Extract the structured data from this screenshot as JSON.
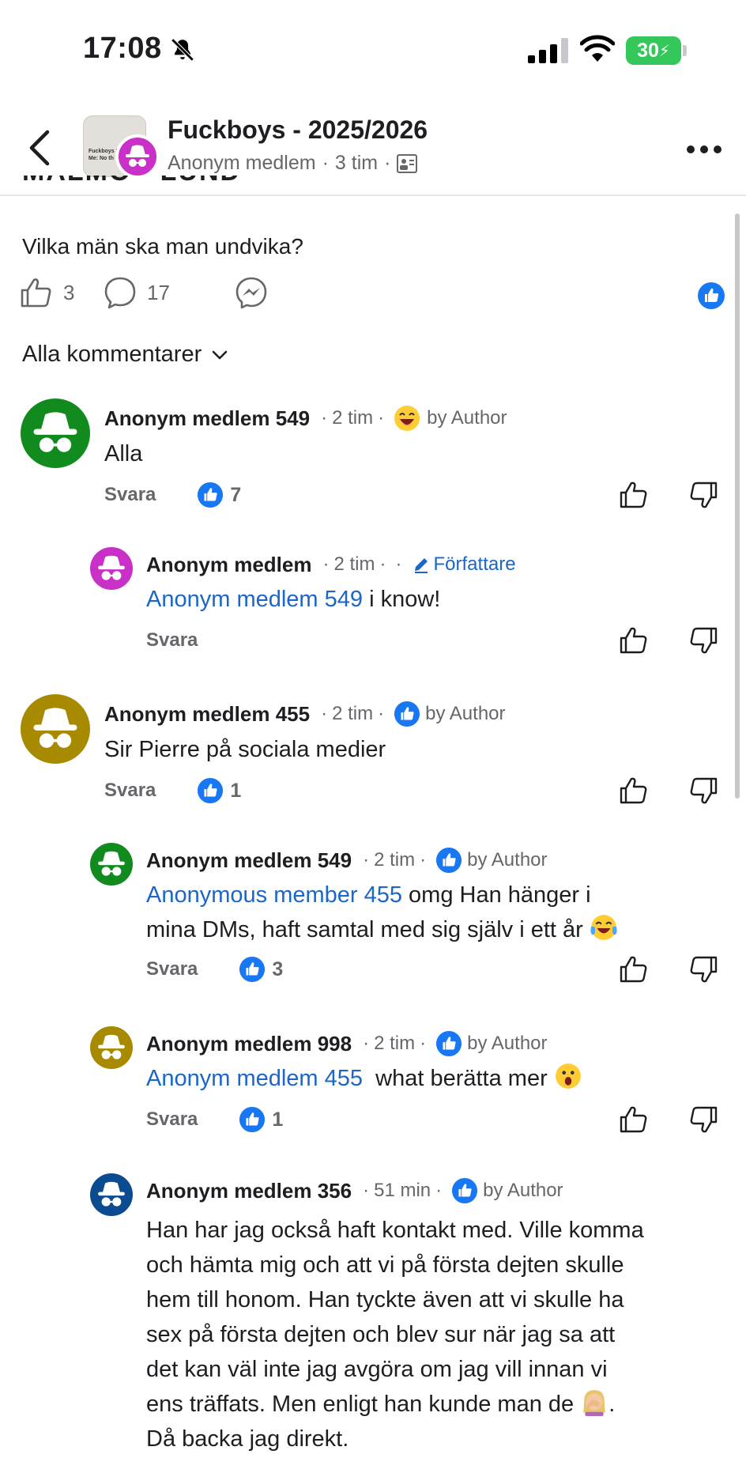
{
  "status": {
    "time": "17:08",
    "battery": "30"
  },
  "header": {
    "title": "Fuckboys - 2025/2026",
    "author": "Anonym medlem",
    "age": "3 tim",
    "thumb_text_1": "Fuckboys I",
    "thumb_text_2": "Me: No th",
    "cropped_text": "MALMÖ - LUND"
  },
  "post": {
    "text": "Vilka män ska man undvika?",
    "likes": "3",
    "comments": "17"
  },
  "sort_label": "Alla kommentarer",
  "reply_label": "Svara",
  "comments": [
    {
      "name": "Anonym medlem 549",
      "age": "2 tim",
      "by": "by Author",
      "text": "Alla",
      "reactions": "7",
      "color": "#118a1e"
    },
    {
      "name": "Anonym medlem",
      "age": "2 tim",
      "tag": "Författare",
      "mention": "Anonym medlem 549",
      "text": " i know!",
      "color": "#c930c8"
    },
    {
      "name": "Anonym medlem 455",
      "age": "2 tim",
      "by": "by Author",
      "text": "Sir Pierre på sociala medier",
      "reactions": "1",
      "color": "#a88a00"
    },
    {
      "name": "Anonym medlem 549",
      "age": "2 tim",
      "by": "by Author",
      "mention": "Anonymous member 455",
      "text_l1": " omg Han hänger i",
      "text_l2": "mina DMs, haft samtal med sig själv i ett år",
      "reactions": "3",
      "color": "#118a1e"
    },
    {
      "name": "Anonym medlem 998",
      "age": "2 tim",
      "by": "by Author",
      "mention": "Anonym medlem 455",
      "text": "  what berätta mer",
      "reactions": "1",
      "color": "#a88a00"
    },
    {
      "name": "Anonym medlem 356",
      "age": "51 min",
      "by": "by Author",
      "lines": [
        "Han har jag också haft kontakt med. Ville komma",
        "och hämta mig och att vi på första dejten skulle",
        "hem till honom. Han tyckte även att vi skulle ha",
        "sex på första dejten och blev sur när jag sa att",
        "det kan väl inte jag avgöra om jag vill innan vi",
        "ens träffats. Men enligt han kunde man de",
        "Då backa jag direkt."
      ],
      "line6_tail": ".",
      "color": "#0b4b8f"
    }
  ],
  "colors": {
    "accent": "#1b66c9",
    "like_blue": "#1877f2",
    "muted": "#65676b",
    "battery": "#34c759"
  }
}
